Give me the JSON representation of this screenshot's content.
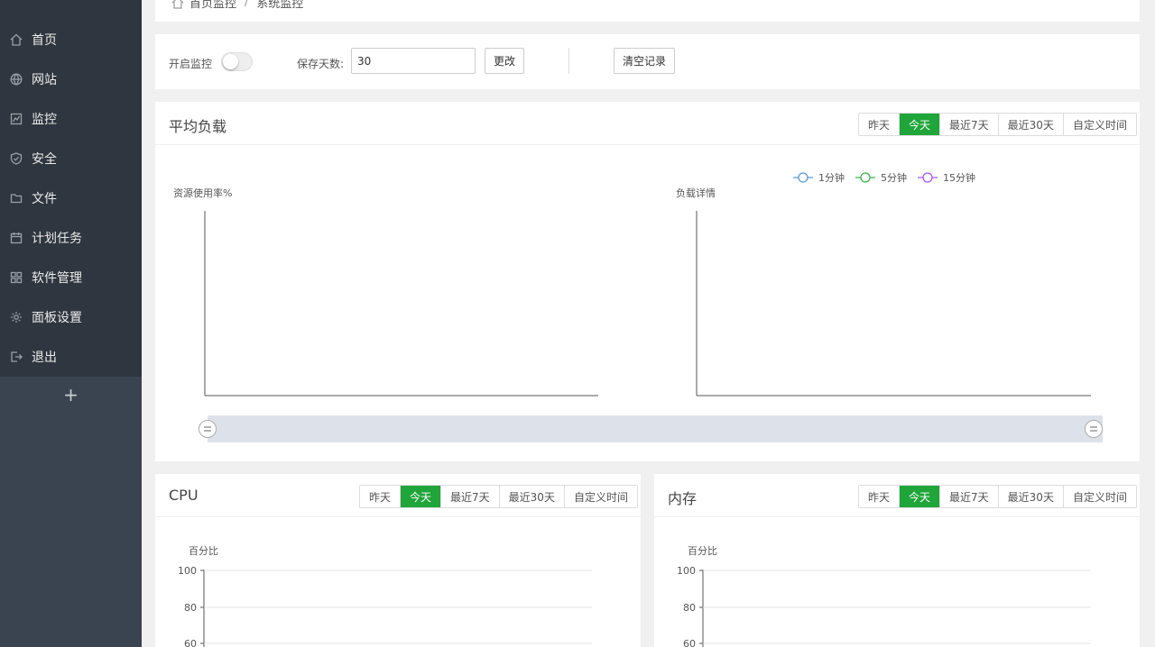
{
  "sidebar": {
    "items": [
      {
        "label": "首页",
        "icon": "home-icon"
      },
      {
        "label": "网站",
        "icon": "globe-icon"
      },
      {
        "label": "监控",
        "icon": "monitor-icon"
      },
      {
        "label": "安全",
        "icon": "shield-icon"
      },
      {
        "label": "文件",
        "icon": "folder-icon"
      },
      {
        "label": "计划任务",
        "icon": "calendar-icon"
      },
      {
        "label": "软件管理",
        "icon": "grid-icon"
      },
      {
        "label": "面板设置",
        "icon": "gear-icon"
      },
      {
        "label": "退出",
        "icon": "logout-icon"
      }
    ],
    "add_label": "+"
  },
  "breadcrumb": {
    "home": "首页监控",
    "separator": "/",
    "current": "系统监控"
  },
  "controls": {
    "monitor_label": "开启监控",
    "monitor_enabled": false,
    "days_label": "保存天数:",
    "days_value": "30",
    "change_button": "更改",
    "clear_button": "清空记录"
  },
  "tabs": [
    "昨天",
    "今天",
    "最近7天",
    "最近30天",
    "自定义时间"
  ],
  "active_tab": "今天",
  "load": {
    "title": "平均负载",
    "left_chart": {
      "ylabel": "资源使用率%"
    },
    "right_chart": {
      "ylabel": "负载详情"
    },
    "legend": [
      {
        "name": "1分钟",
        "color": "#5b9bd5"
      },
      {
        "name": "5分钟",
        "color": "#3bb34a"
      },
      {
        "name": "15分钟",
        "color": "#a855f7"
      }
    ],
    "slider_handle": "="
  },
  "cpu": {
    "title": "CPU",
    "ylabel": "百分比",
    "ticks": [
      "100",
      "80",
      "60"
    ]
  },
  "memory": {
    "title": "内存",
    "ylabel": "百分比",
    "ticks": [
      "100",
      "80",
      "60"
    ]
  },
  "colors": {
    "accent": "#20a53a",
    "sidebar_bg": "#3a4450",
    "sidebar_menu_bg": "#2f363f"
  }
}
